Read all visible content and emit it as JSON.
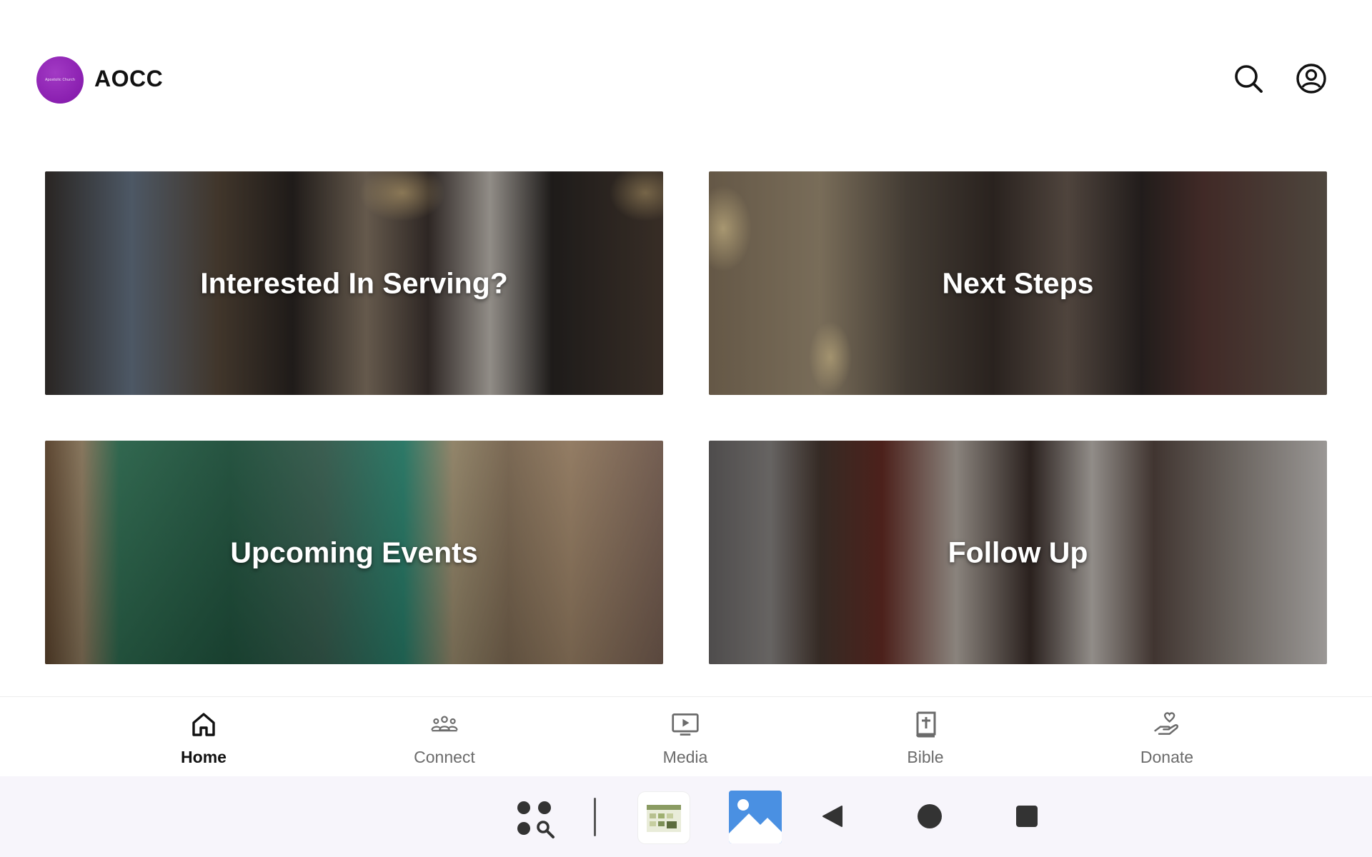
{
  "header": {
    "logo_text": "Apostolic Church",
    "title": "AOCC",
    "icons": [
      "search-icon",
      "account-icon"
    ]
  },
  "cards": [
    {
      "label": "Interested In Serving?"
    },
    {
      "label": "Next Steps"
    },
    {
      "label": "Upcoming Events"
    },
    {
      "label": "Follow Up"
    }
  ],
  "bottom_nav": {
    "active": "Home",
    "items": [
      {
        "label": "Home",
        "icon": "home-icon"
      },
      {
        "label": "Connect",
        "icon": "people-icon"
      },
      {
        "label": "Media",
        "icon": "tv-play-icon"
      },
      {
        "label": "Bible",
        "icon": "bible-icon"
      },
      {
        "label": "Donate",
        "icon": "hand-heart-icon"
      }
    ]
  },
  "system_bar": {
    "icons": [
      "apps-search-icon",
      "calendar-app-icon",
      "gallery-app-icon",
      "back-icon",
      "home-circle-icon",
      "recents-icon"
    ]
  },
  "colors": {
    "brand": "#8a1fb0",
    "active_nav": "#111111",
    "inactive_nav": "#6b6b6b"
  }
}
